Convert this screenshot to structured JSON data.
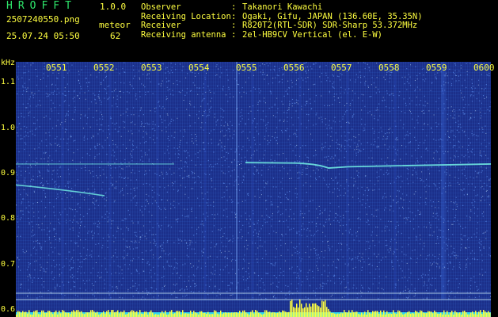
{
  "header": {
    "app_title": "HROFFT",
    "app_version": "1.0.0",
    "file_name": "2507240550.png",
    "meteor_label": "meteor",
    "meteor_count": "62",
    "date_time": "25.07.24 05:50"
  },
  "station_info": [
    {
      "key": "Observer",
      "colon": ":",
      "value": "Takanori Kawachi"
    },
    {
      "key": "Receiving Location",
      "colon": ":",
      "value": "Ogaki, Gifu, JAPAN (136.60E, 35.35N)"
    },
    {
      "key": "Receiver",
      "colon": ":",
      "value": "R820T2(RTL-SDR) SDR-Sharp 53.372MHz"
    },
    {
      "key": "Receiving antenna",
      "colon": ":",
      "value": "2el-HB9CV Vertical (el. E-W)"
    }
  ],
  "y_axis": {
    "unit": "kHz",
    "ticks": [
      {
        "label": "1.1",
        "value": 1.1
      },
      {
        "label": "1.0",
        "value": 1.0
      },
      {
        "label": "0.9",
        "value": 0.9
      },
      {
        "label": "0.8",
        "value": 0.8
      },
      {
        "label": "0.7",
        "value": 0.7
      },
      {
        "label": "0.6",
        "value": 0.6
      }
    ],
    "range": [
      0.584,
      1.146
    ]
  },
  "x_axis": {
    "ticks": [
      "0551",
      "0552",
      "0553",
      "0554",
      "0555",
      "0556",
      "0557",
      "0558",
      "0559",
      "0600"
    ],
    "range_minutes": [
      0,
      10
    ]
  },
  "colors": {
    "text_yellow": "#ffff40",
    "title_green": "#2ee66b",
    "background_blue": "#1b2f8a",
    "signal_cyan": "#6fe8e0",
    "baseline_line": "#a8c8e8",
    "bottom_yellow": "#ffff40",
    "bottom_cyan": "#30d8f0"
  }
}
